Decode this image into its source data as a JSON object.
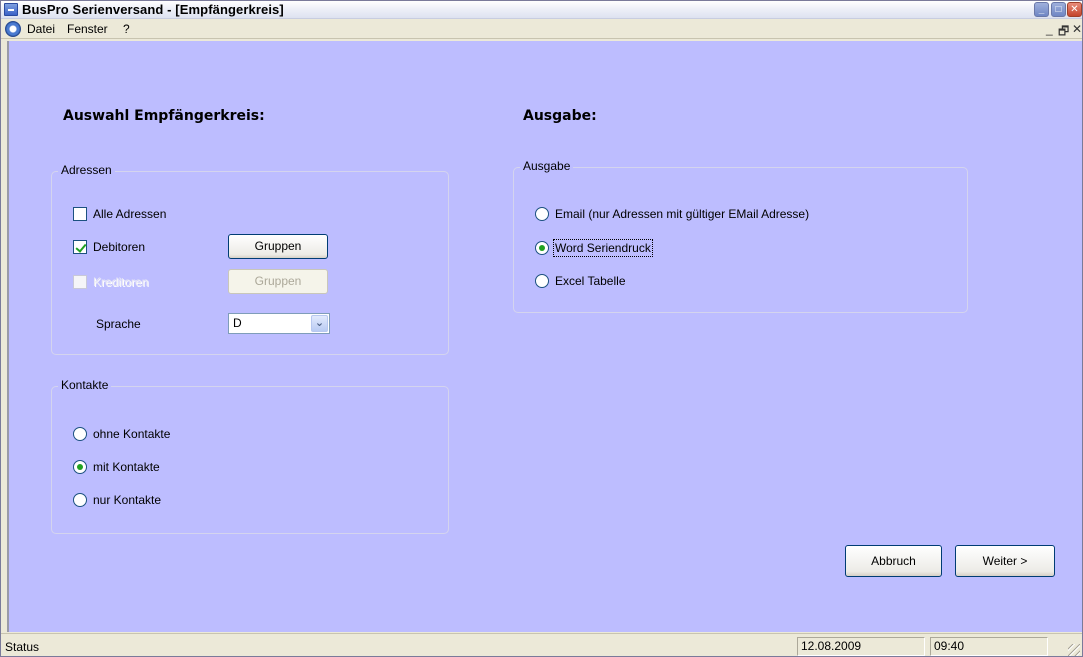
{
  "window": {
    "title": "BusPro Serienversand - [Empfängerkreis]",
    "controls": {
      "minimize": "_",
      "restore": "□",
      "close": "✕"
    }
  },
  "menu": {
    "items": [
      "Datei",
      "Fenster",
      "?"
    ],
    "mdi": {
      "minimize": "_",
      "restore": "🗗",
      "close": "✕"
    }
  },
  "left": {
    "heading": "Auswahl Empfängerkreis:",
    "addresses": {
      "legend": "Adressen",
      "all_label": "Alle Adressen",
      "debitors_label": "Debitoren",
      "creditors_label": "Kreditoren",
      "groups_label": "Gruppen",
      "groups_label_disabled": "Gruppen",
      "language_label": "Sprache",
      "language_value": "D"
    },
    "contacts": {
      "legend": "Kontakte",
      "options": [
        "ohne Kontakte",
        "mit Kontakte",
        "nur Kontakte"
      ],
      "selected_index": 1
    }
  },
  "right": {
    "heading": "Ausgabe:",
    "output": {
      "legend": "Ausgabe",
      "options": [
        "Email (nur Adressen mit gültiger EMail Adresse)",
        "Word Seriendruck",
        "Excel Tabelle"
      ],
      "selected_index": 1
    }
  },
  "buttons": {
    "cancel": "Abbruch",
    "next": "Weiter >"
  },
  "status": {
    "text": "Status",
    "date": "12.08.2009",
    "time": "09:40"
  },
  "colors": {
    "client_background": "#BDBDFF",
    "window_chrome": "#ECE9D8"
  }
}
